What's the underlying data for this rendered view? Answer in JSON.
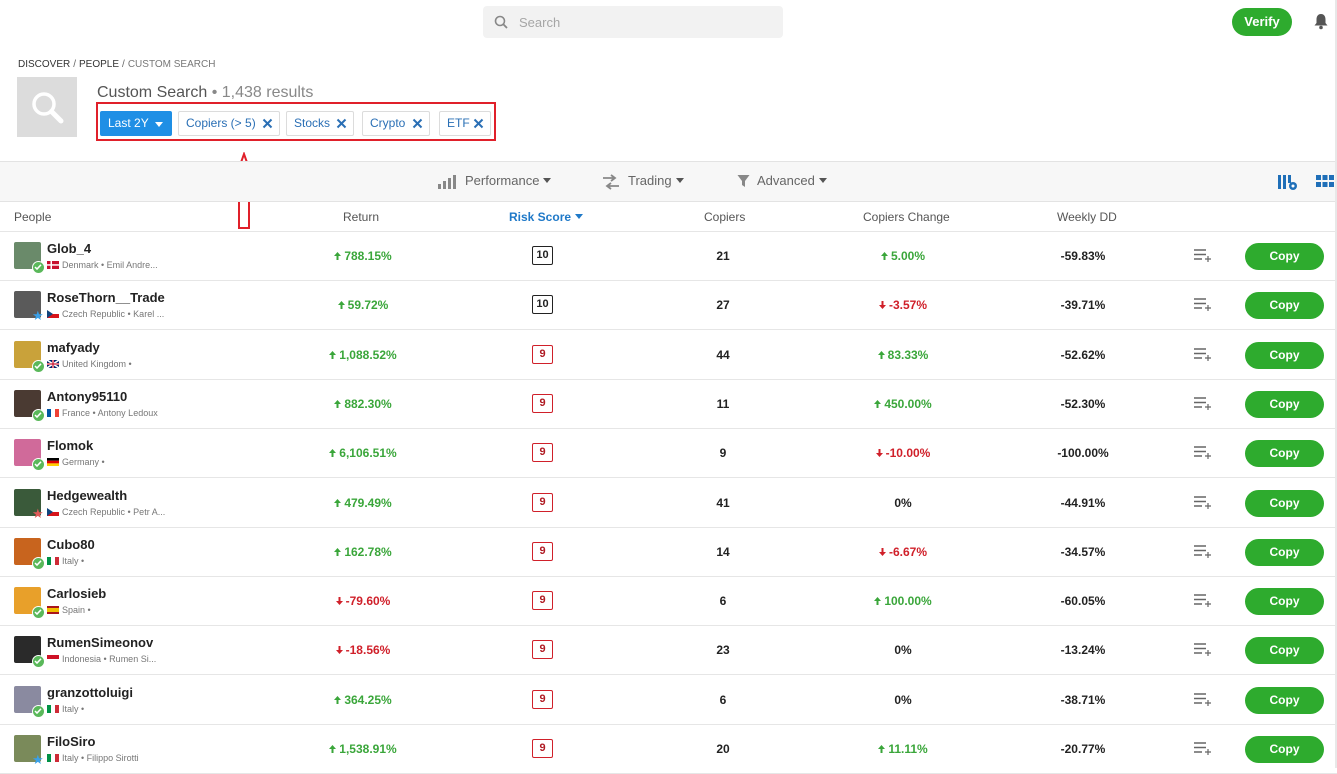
{
  "header": {
    "search_placeholder": "Search",
    "verify_label": "Verify"
  },
  "breadcrumb": [
    "DISCOVER",
    "PEOPLE",
    "CUSTOM SEARCH"
  ],
  "breadcrumb_sep": "/",
  "title": "Custom Search",
  "results": "• 1,438 results",
  "filters": [
    "Last 2Y",
    "Copiers (> 5)",
    "Stocks",
    "Crypto",
    "ETF"
  ],
  "toolbar": {
    "performance": "Performance",
    "trading": "Trading",
    "advanced": "Advanced"
  },
  "columns": [
    "People",
    "Return",
    "Risk Score",
    "Copiers",
    "Copiers Change",
    "Weekly DD"
  ],
  "copy_label": "Copy",
  "rows": [
    {
      "name": "Glob_4",
      "sub": "Denmark • Emil Andre...",
      "ret": "788.15%",
      "ret_dir": "up",
      "risk": "10",
      "copiers": "21",
      "change": "5.00%",
      "change_dir": "up",
      "dd": "-59.83%",
      "badge": "green",
      "flag": "dk",
      "av": "#6a8a6a"
    },
    {
      "name": "RoseThorn__Trade",
      "sub": "Czech Republic • Karel ...",
      "ret": "59.72%",
      "ret_dir": "up",
      "risk": "10",
      "copiers": "27",
      "change": "-3.57%",
      "change_dir": "down",
      "dd": "-39.71%",
      "badge": "star",
      "flag": "cz",
      "av": "#5a5a5a"
    },
    {
      "name": "mafyady",
      "sub": "United Kingdom •",
      "ret": "1,088.52%",
      "ret_dir": "up",
      "risk": "9",
      "copiers": "44",
      "change": "83.33%",
      "change_dir": "up",
      "dd": "-52.62%",
      "badge": "green",
      "flag": "gb",
      "av": "#c9a23a"
    },
    {
      "name": "Antony95110",
      "sub": "France • Antony Ledoux",
      "ret": "882.30%",
      "ret_dir": "up",
      "risk": "9",
      "copiers": "11",
      "change": "450.00%",
      "change_dir": "up",
      "dd": "-52.30%",
      "badge": "green",
      "flag": "fr",
      "av": "#4a3a32"
    },
    {
      "name": "Flomok",
      "sub": "Germany •",
      "ret": "6,106.51%",
      "ret_dir": "up",
      "risk": "9",
      "copiers": "9",
      "change": "-10.00%",
      "change_dir": "down",
      "dd": "-100.00%",
      "badge": "green",
      "flag": "de",
      "av": "#d06a9a"
    },
    {
      "name": "Hedgewealth",
      "sub": "Czech Republic • Petr A...",
      "ret": "479.49%",
      "ret_dir": "up",
      "risk": "9",
      "copiers": "41",
      "change": "0%",
      "change_dir": "none",
      "dd": "-44.91%",
      "badge": "star-red",
      "flag": "cz",
      "av": "#3a5a3a"
    },
    {
      "name": "Cubo80",
      "sub": "Italy •",
      "ret": "162.78%",
      "ret_dir": "up",
      "risk": "9",
      "copiers": "14",
      "change": "-6.67%",
      "change_dir": "down",
      "dd": "-34.57%",
      "badge": "green",
      "flag": "it",
      "av": "#c8641e"
    },
    {
      "name": "Carlosieb",
      "sub": "Spain •",
      "ret": "-79.60%",
      "ret_dir": "down",
      "risk": "9",
      "copiers": "6",
      "change": "100.00%",
      "change_dir": "up",
      "dd": "-60.05%",
      "badge": "green",
      "flag": "es",
      "av": "#e8a02a"
    },
    {
      "name": "RumenSimeonov",
      "sub": "Indonesia • Rumen Si...",
      "ret": "-18.56%",
      "ret_dir": "down",
      "risk": "9",
      "copiers": "23",
      "change": "0%",
      "change_dir": "none",
      "dd": "-13.24%",
      "badge": "green",
      "flag": "id",
      "av": "#2a2a2a"
    },
    {
      "name": "granzottoluigi",
      "sub": "Italy •",
      "ret": "364.25%",
      "ret_dir": "up",
      "risk": "9",
      "copiers": "6",
      "change": "0%",
      "change_dir": "none",
      "dd": "-38.71%",
      "badge": "green",
      "flag": "it",
      "av": "#8a8aa0"
    },
    {
      "name": "FiloSiro",
      "sub": "Italy • Filippo Sirotti",
      "ret": "1,538.91%",
      "ret_dir": "up",
      "risk": "9",
      "copiers": "20",
      "change": "11.11%",
      "change_dir": "up",
      "dd": "-20.77%",
      "badge": "star",
      "flag": "it",
      "av": "#7a8a5a"
    }
  ]
}
